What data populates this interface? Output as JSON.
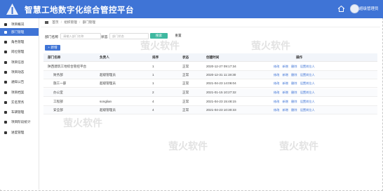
{
  "header": {
    "title": "智慧工地数字化综合管控平台",
    "user_name": "超级管理员"
  },
  "sidebar": {
    "items": [
      {
        "label": "项目概况"
      },
      {
        "label": "部门管理"
      },
      {
        "label": "角色管理"
      },
      {
        "label": "岗位管理"
      },
      {
        "label": "项目信息"
      },
      {
        "label": "项目动态"
      },
      {
        "label": "通知公告"
      },
      {
        "label": "项目档案"
      },
      {
        "label": "实名劳务"
      },
      {
        "label": "车辆管理"
      },
      {
        "label": "项目阶段统计"
      },
      {
        "label": "进度管理"
      }
    ]
  },
  "breadcrumb": {
    "items": [
      "首页",
      "组织管理",
      "部门管理"
    ]
  },
  "filters": {
    "dept_label": "部门名称",
    "dept_placeholder": "请输入部门名称",
    "status_label": "状态",
    "status_placeholder": "部门状态",
    "search_label": "搜索",
    "reset_label": "重置"
  },
  "toolbar": {
    "add_label": "+ 新增"
  },
  "table": {
    "columns": [
      "部门名称",
      "负责人",
      "排序",
      "状态",
      "创建时间",
      "操作"
    ],
    "rows": [
      {
        "name": "陕西建筑工地综合管控平台",
        "leader": "",
        "sort": "1",
        "status": "正常",
        "created": "2020-12-27 09:17:34",
        "ops": [
          "修改",
          "新增",
          "删除",
          "设置岗位人"
        ]
      },
      {
        "name": "财务部",
        "leader": "超级管理员",
        "sort": "1",
        "status": "正常",
        "created": "2020-12-31 11:19:30",
        "ops": [
          "修改",
          "新增",
          "删除",
          "设置岗位人"
        ]
      },
      {
        "name": "施工一部",
        "leader": "超级管理员",
        "sort": "1",
        "status": "正常",
        "created": "2021-04-23 14:06:04",
        "ops": [
          "修改",
          "新增",
          "删除",
          "设置岗位人"
        ]
      },
      {
        "name": "办公室",
        "leader": "",
        "sort": "2",
        "status": "正常",
        "created": "2021-01-15 10:27:32",
        "ops": [
          "修改",
          "新增",
          "删除",
          "设置岗位人"
        ]
      },
      {
        "name": "工程部",
        "leader": "songlian",
        "sort": "4",
        "status": "正常",
        "created": "2021-04-23 15:48:15",
        "ops": [
          "修改",
          "新增",
          "删除",
          "设置岗位人"
        ]
      },
      {
        "name": "安全部",
        "leader": "超级管理员",
        "sort": "4",
        "status": "正常",
        "created": "2021-04-23 10:30:33",
        "ops": [
          "修改",
          "新增",
          "删除",
          "设置岗位人"
        ]
      }
    ]
  },
  "watermark": {
    "text": "萤火软件"
  },
  "colors": {
    "primary": "#3f74d6",
    "search_button": "#3fb8a0",
    "sidebar_active": "#3f74d6"
  }
}
